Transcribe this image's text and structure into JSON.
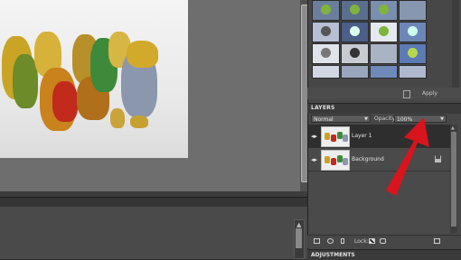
{
  "effects_panel": {
    "apply_label": "Apply"
  },
  "layers_panel": {
    "title": "LAYERS",
    "blend_mode": "Normal",
    "opacity_label": "Opacity:",
    "opacity_value": "100%",
    "layers": [
      {
        "name": "Layer 1",
        "selected": true,
        "locked": false
      },
      {
        "name": "Background",
        "selected": false,
        "locked": true
      }
    ],
    "lock_label": "Lock:",
    "footer_icons": [
      "new-layer-icon",
      "adjustment-layer-icon",
      "link-icon",
      "lock-transparent-icon",
      "lock-all-icon",
      "delete-layer-icon"
    ]
  },
  "adjustments_panel": {
    "title": "ADJUSTMENTS"
  },
  "annotation": {
    "arrow_color": "#d8141c"
  }
}
